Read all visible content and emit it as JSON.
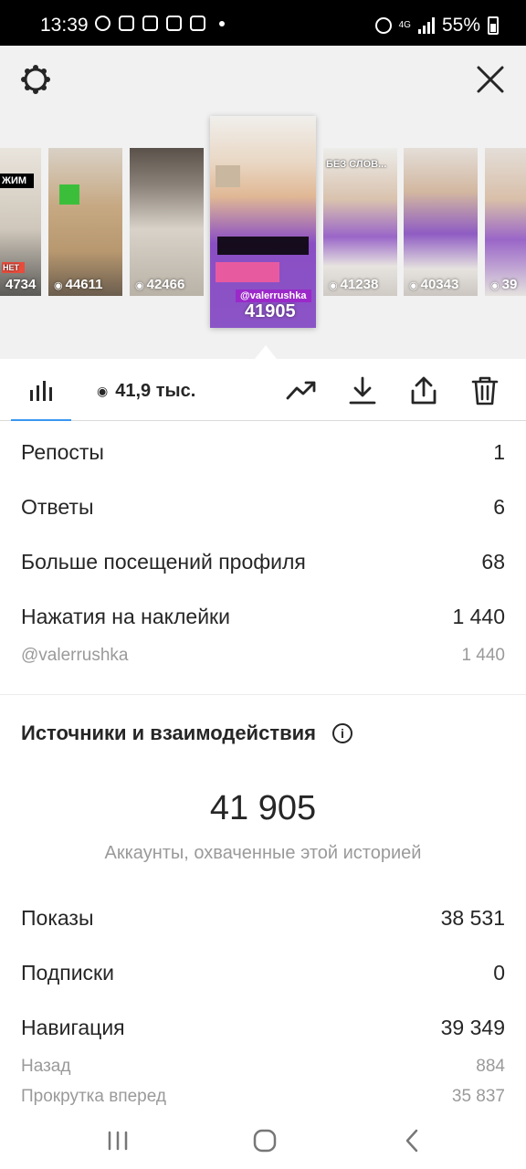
{
  "status_bar": {
    "time": "13:39",
    "network": "4G",
    "battery": "55%"
  },
  "stories": [
    {
      "views": "4734"
    },
    {
      "views": "44611"
    },
    {
      "views": "42466"
    },
    {
      "views": "41905",
      "tag": "@valerrushka",
      "active": true
    },
    {
      "views": "41238",
      "caption": "БЕЗ СЛОВ..."
    },
    {
      "views": "40343"
    },
    {
      "views": "39"
    }
  ],
  "toolbar": {
    "views_short": "41,9 тыс."
  },
  "interactions": [
    {
      "label": "Репосты",
      "value": "1"
    },
    {
      "label": "Ответы",
      "value": "6"
    },
    {
      "label": "Больше посещений профиля",
      "value": "68"
    },
    {
      "label": "Нажатия на наклейки",
      "value": "1 440"
    }
  ],
  "sticker": {
    "label": "@valerrushka",
    "value": "1 440"
  },
  "discovery": {
    "title": "Источники и взаимодействия",
    "reach": "41 905",
    "reach_label": "Аккаунты, охваченные этой историей",
    "rows": [
      {
        "label": "Показы",
        "value": "38 531"
      },
      {
        "label": "Подписки",
        "value": "0"
      },
      {
        "label": "Навигация",
        "value": "39 349"
      }
    ],
    "sub_rows": [
      {
        "label": "Назад",
        "value": "884"
      },
      {
        "label": "Прокрутка вперед",
        "value": "35 837"
      }
    ]
  },
  "colors": {
    "accent": "#3897f0",
    "tag": "#9b29c9"
  }
}
